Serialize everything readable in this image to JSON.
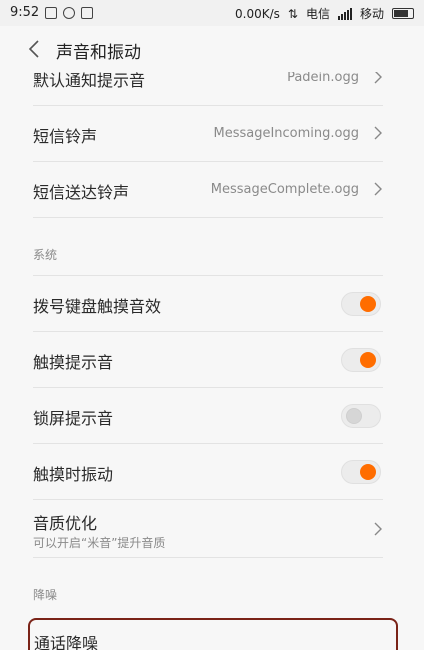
{
  "status_bar": {
    "time": "9:52",
    "speed": "0.00K/s",
    "carrier1": "电信",
    "carrier2": "移动",
    "icons": [
      "notification-icon",
      "weibo-icon",
      "message-icon",
      "wifi-icon",
      "signal-icon",
      "battery-icon"
    ]
  },
  "header": {
    "back_icon": "chevron-left-icon",
    "title": "声音和振动"
  },
  "rows_top": [
    {
      "label": "默认通知提示音",
      "value": "Padein.ogg"
    },
    {
      "label": "短信铃声",
      "value": "MessageIncoming.ogg"
    },
    {
      "label": "短信送达铃声",
      "value": "MessageComplete.ogg"
    }
  ],
  "section_system": {
    "label": "系统"
  },
  "toggles": [
    {
      "label": "拨号键盘触摸音效",
      "on": true
    },
    {
      "label": "触摸提示音",
      "on": true
    },
    {
      "label": "锁屏提示音",
      "on": false
    },
    {
      "label": "触摸时振动",
      "on": true
    }
  ],
  "quality": {
    "label": "音质优化",
    "sub": "可以开启“米音”提升音质"
  },
  "section_noise": {
    "label": "降噪"
  },
  "call_noise": {
    "label": "通话降噪"
  },
  "colors": {
    "accent": "#ff6d00",
    "highlight_border": "#7a2318"
  }
}
